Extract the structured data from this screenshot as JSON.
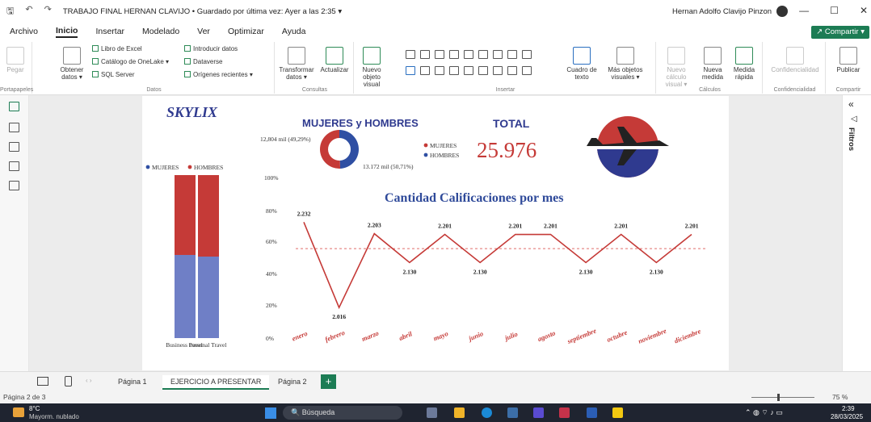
{
  "window": {
    "title": "TRABAJO FINAL HERNAN CLAVIJO • Guardado por última vez: Ayer a las 2:35 ▾",
    "user": "Hernan Adolfo Clavijo Pinzon"
  },
  "menu": [
    "Archivo",
    "Inicio",
    "Insertar",
    "Modelado",
    "Ver",
    "Optimizar",
    "Ayuda"
  ],
  "share_label": "Compartir ▾",
  "ribbon": {
    "portapapeles": {
      "pegar": "Pegar",
      "label": "Portapapeles"
    },
    "datos": {
      "obtener": "Obtener datos ▾",
      "excel": "Libro de Excel",
      "onelake": "Catálogo de OneLake ▾",
      "sql": "SQL Server",
      "introducir": "Introducir datos",
      "dataverse": "Dataverse",
      "origenes": "Orígenes recientes ▾",
      "label": "Datos"
    },
    "consultas": {
      "transformar": "Transformar datos ▾",
      "actualizar": "Actualizar",
      "label": "Consultas"
    },
    "insertar": {
      "nuevo_objeto": "Nuevo objeto visual",
      "cuadro_texto": "Cuadro de texto",
      "mas_objetos": "Más objetos visuales ▾",
      "label": "Insertar"
    },
    "calculos": {
      "nuevo_calculo": "Nuevo cálculo visual ▾",
      "nueva_medida": "Nueva medida",
      "medida_rapida": "Medida rápida",
      "label": "Cálculos"
    },
    "confidencialidad": {
      "btn": "Confidencialidad",
      "label": "Confidencialidad"
    },
    "compartir": {
      "publicar": "Publicar",
      "label": "Compartir"
    }
  },
  "report": {
    "brand": "SKYLIX",
    "donut_title": "MUJERES y HOMBRES",
    "donut_label_top": "12,804 mil (49,29%)",
    "donut_label_bottom": "13.172 mil (50,71%)",
    "donut_legend": [
      "MUJERES",
      "HOMBRES"
    ],
    "total_label": "TOTAL",
    "total_value": "25.976",
    "stack_legend": [
      "MUJERES",
      "HOMBRES"
    ],
    "stack_categories": [
      "Business travel",
      "Personal Travel"
    ],
    "stack_yticks": [
      "100%",
      "80%",
      "60%",
      "40%",
      "20%",
      "0%"
    ],
    "line_title": "Cantidad Calificaciones por mes"
  },
  "chart_data": [
    {
      "type": "pie",
      "title": "MUJERES y HOMBRES",
      "labels": [
        "MUJERES",
        "HOMBRES"
      ],
      "values": [
        12804,
        13172
      ],
      "percent": [
        49.29,
        50.71
      ],
      "colors": [
        "#2f4fa3",
        "#c53a37"
      ]
    },
    {
      "type": "bar",
      "stacked": "percent",
      "categories": [
        "Business travel",
        "Personal Travel"
      ],
      "series": [
        {
          "name": "MUJERES",
          "values": [
            51,
            50
          ],
          "color": "#6f7fc6"
        },
        {
          "name": "HOMBRES",
          "values": [
            49,
            50
          ],
          "color": "#c53a37"
        }
      ],
      "ylim": [
        0,
        100
      ]
    },
    {
      "type": "line",
      "title": "Cantidad Calificaciones por mes",
      "categories": [
        "enero",
        "febrero",
        "marzo",
        "abril",
        "mayo",
        "junio",
        "julio",
        "agosto",
        "septiembre",
        "octubre",
        "noviembre",
        "diciembre"
      ],
      "values": [
        2232,
        2016,
        2203,
        2130,
        2201,
        2130,
        2201,
        2201,
        2130,
        2201,
        2130,
        2201
      ],
      "labels": [
        "2.232",
        "2.016",
        "2.203",
        "2.130",
        "2.201",
        "2.130",
        "2.201",
        "2.201",
        "2.130",
        "2.201",
        "2.130",
        "2.201"
      ],
      "reference_line": 2165,
      "ylim": [
        2000,
        2245
      ],
      "color": "#c53a37"
    }
  ],
  "tabs": [
    "Página 1",
    "EJERCICIO A PRESENTAR",
    "Página 2"
  ],
  "status": {
    "page": "Página 2 de 3",
    "zoom": "75 %"
  },
  "taskbar": {
    "temp": "8°C",
    "weather": "Mayorm. nublado",
    "search": "Búsqueda",
    "time": "2:39",
    "date": "28/03/2025"
  }
}
